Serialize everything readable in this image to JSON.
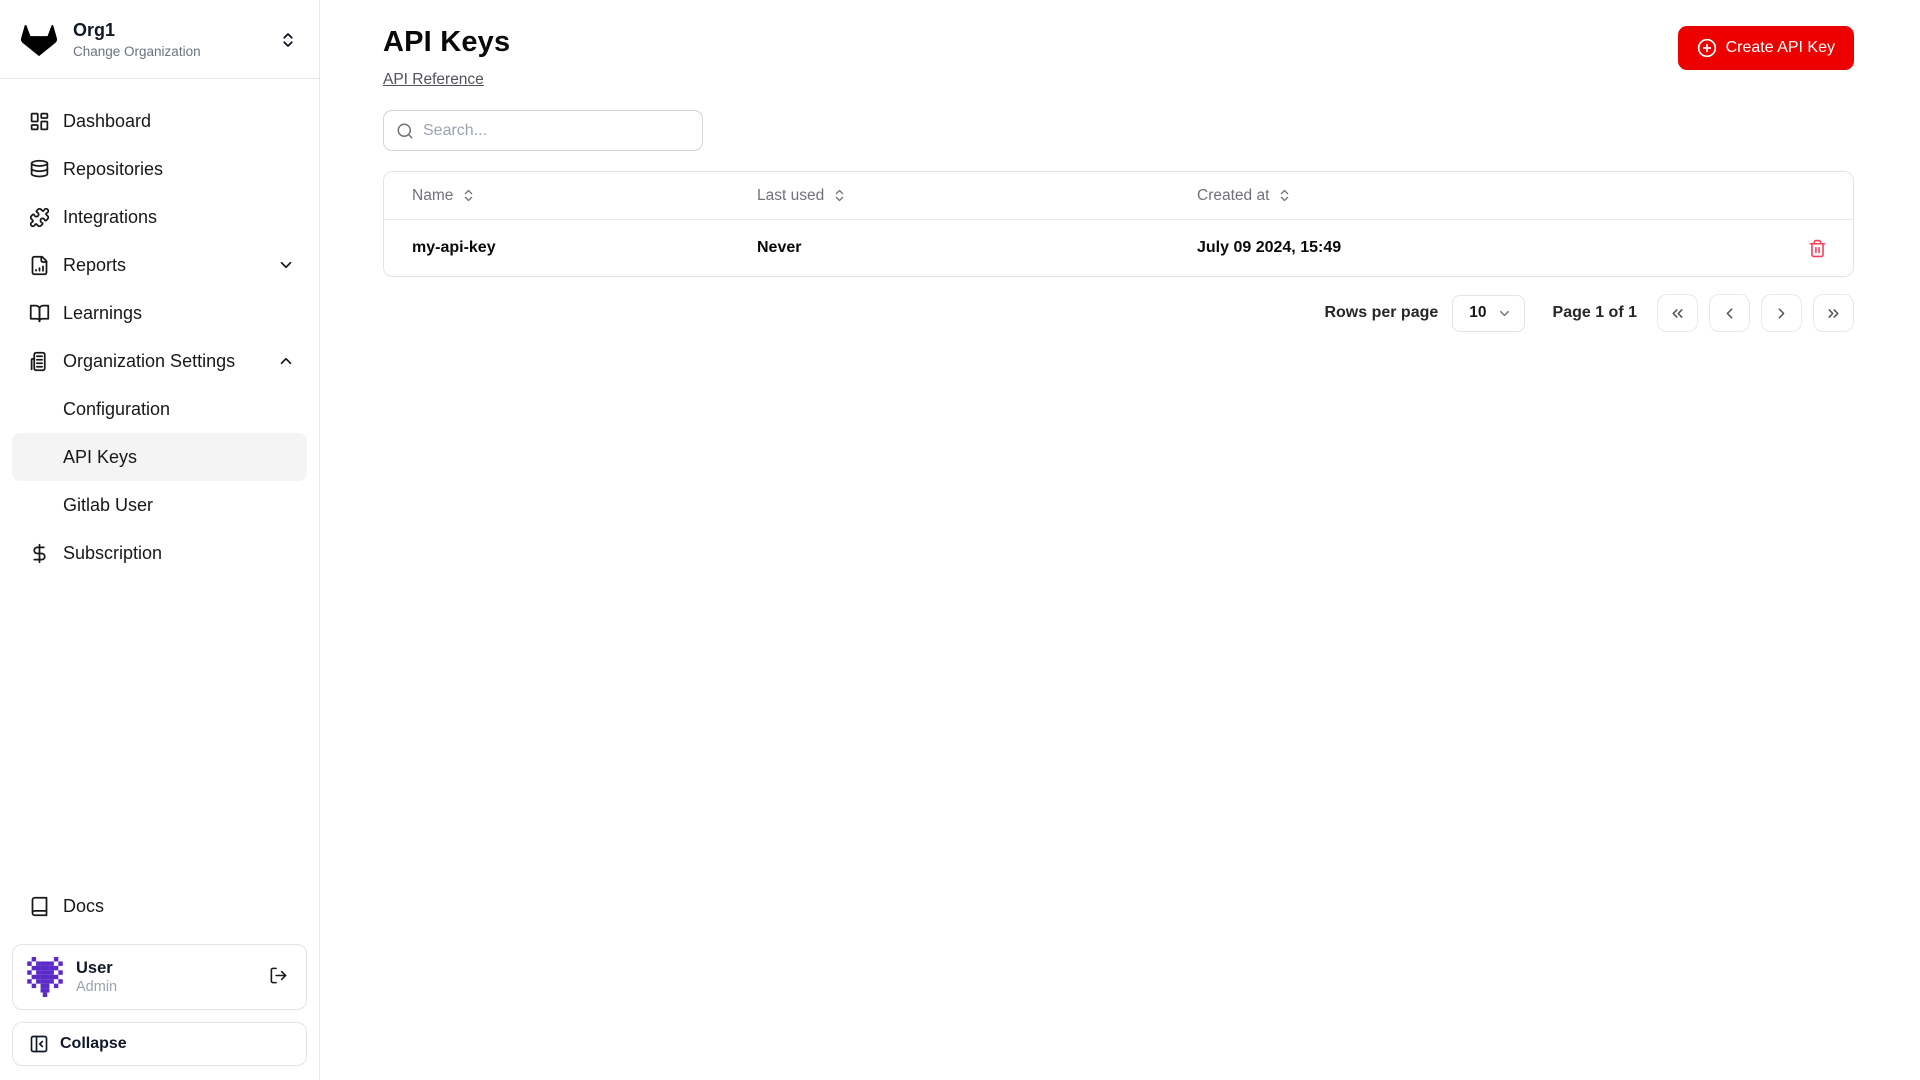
{
  "sidebar": {
    "org": {
      "name": "Org1",
      "subtitle": "Change Organization"
    },
    "nav": [
      {
        "label": "Dashboard"
      },
      {
        "label": "Repositories"
      },
      {
        "label": "Integrations"
      },
      {
        "label": "Reports"
      },
      {
        "label": "Learnings"
      },
      {
        "label": "Organization Settings"
      },
      {
        "label": "Configuration"
      },
      {
        "label": "API Keys"
      },
      {
        "label": "Gitlab User"
      },
      {
        "label": "Subscription"
      }
    ],
    "docs_label": "Docs",
    "user": {
      "name": "User",
      "role": "Admin"
    },
    "collapse_label": "Collapse"
  },
  "main": {
    "title": "API Keys",
    "reference_link": "API Reference",
    "search_placeholder": "Search...",
    "create_button": "Create API Key",
    "table": {
      "columns": [
        "Name",
        "Last used",
        "Created at"
      ],
      "rows": [
        {
          "name": "my-api-key",
          "last_used": "Never",
          "created_at": "July 09 2024, 15:49"
        }
      ]
    },
    "pagination": {
      "rows_per_page_label": "Rows per page",
      "rows_per_page_value": "10",
      "page_status": "Page 1 of 1"
    }
  },
  "colors": {
    "accent_red": "#ed0000",
    "danger_rose": "#f43f5e",
    "avatar_purple": "#5b2bc7",
    "active_item_bg": "#f4f4f5"
  }
}
